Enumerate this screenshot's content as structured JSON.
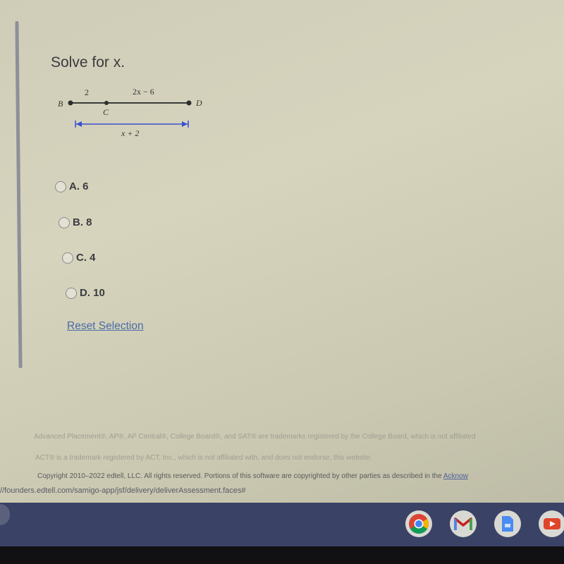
{
  "question": {
    "prompt": "Solve for x.",
    "diagram": {
      "points": [
        "B",
        "C",
        "D"
      ],
      "segment_labels": {
        "BC": "2",
        "CD": "2x − 6",
        "BD": "x + 2"
      },
      "colors": {
        "segment": "#3a3a3a",
        "measure": "#3b4fd0"
      }
    }
  },
  "options": [
    {
      "label": "A. 6",
      "selected": false
    },
    {
      "label": "B. 8",
      "selected": false
    },
    {
      "label": "C. 4",
      "selected": false
    },
    {
      "label": "D. 10",
      "selected": false
    }
  ],
  "reset_label": "Reset Selection",
  "footer": {
    "trademark_1": "Advanced Placement®, AP®, AP Central®, College Board®, and SAT® are trademarks registered by the College Board, which is not affiliated",
    "trademark_2": "ACT® is a trademark registered by ACT, Inc., which is not affiliated with, and does not endorse, this website.",
    "copyright": "Copyright 2010–2022 edtell, LLC. All rights reserved. Portions of this software are copyrighted by other parties as described in the",
    "copyright_link": "Acknow"
  },
  "status_url": "//founders.edtell.com/samigo-app/jsf/delivery/deliverAssessment.faces#",
  "shelf": {
    "apps": [
      "chrome-icon",
      "gmail-icon",
      "docs-icon",
      "youtube-icon"
    ]
  }
}
